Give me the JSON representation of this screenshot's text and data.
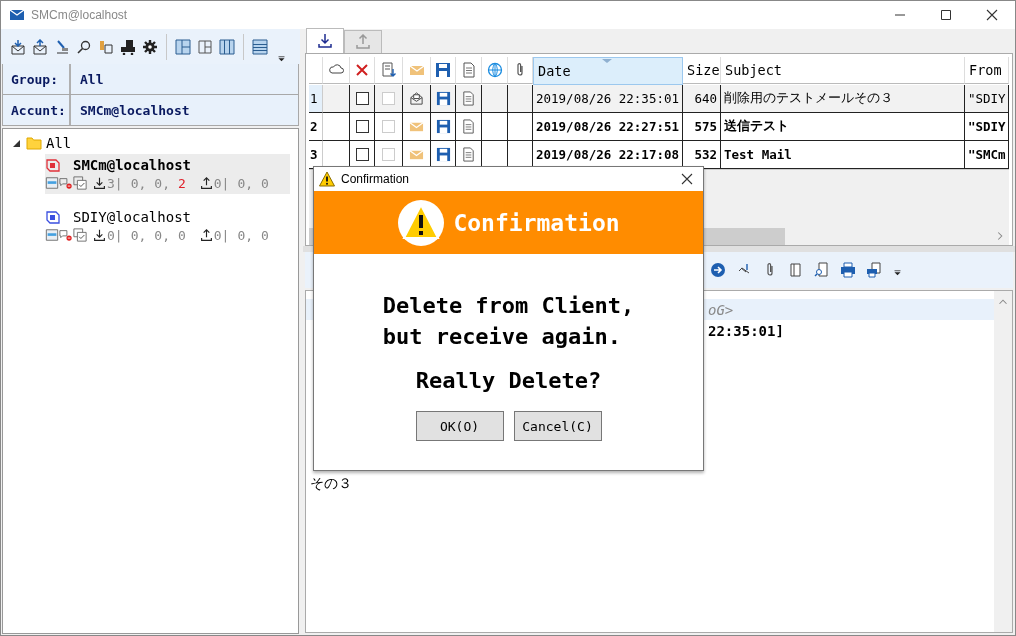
{
  "window": {
    "title": "SMCm@localhost"
  },
  "sidebar": {
    "group": {
      "label": "Group:",
      "value": "All"
    },
    "account": {
      "label": "Accunt:",
      "value": "SMCm@localhost"
    },
    "tree": [
      {
        "label": "All",
        "expanded": true,
        "children": [
          {
            "label": "SMCm@localhost",
            "selected": true,
            "color": "#e0303a",
            "received": [
              {
                "text": "3|",
                "alert": false
              },
              {
                "text": "0,",
                "alert": false
              },
              {
                "text": "0,",
                "alert": false
              },
              {
                "text": "2",
                "alert": true
              }
            ],
            "sent": [
              {
                "text": "0|",
                "alert": false
              },
              {
                "text": "0,",
                "alert": false
              },
              {
                "text": "0",
                "alert": false
              }
            ]
          },
          {
            "label": "SDIY@localhost",
            "selected": false,
            "color": "#3a4fe0",
            "received": [
              {
                "text": "0|",
                "alert": false
              },
              {
                "text": "0,",
                "alert": false
              },
              {
                "text": "0,",
                "alert": false
              },
              {
                "text": "0",
                "alert": false
              }
            ],
            "sent": [
              {
                "text": "0|",
                "alert": false
              },
              {
                "text": "0,",
                "alert": false
              },
              {
                "text": "0",
                "alert": false
              }
            ]
          }
        ]
      }
    ]
  },
  "tabs": [
    {
      "kind": "receive",
      "selected": true
    },
    {
      "kind": "send",
      "selected": false
    }
  ],
  "table": {
    "columns": [
      {
        "kind": "cloud"
      },
      {
        "kind": "delete"
      },
      {
        "kind": "fetch"
      },
      {
        "kind": "mail"
      },
      {
        "kind": "save"
      },
      {
        "kind": "document"
      },
      {
        "kind": "web"
      },
      {
        "kind": "attachment"
      },
      {
        "kind": "text",
        "label": "Date",
        "sorted": true
      },
      {
        "kind": "text",
        "label": "Size",
        "sorted": false
      },
      {
        "kind": "text",
        "label": "Subject",
        "sorted": false
      },
      {
        "kind": "text",
        "label": "From",
        "sorted": false
      }
    ],
    "rows": [
      {
        "number": "1",
        "selected": true,
        "unread": false,
        "checked": false,
        "fetch": {
          "checked": false,
          "disabled": true
        },
        "date": "2019/08/26 22:35:01",
        "size": "640",
        "subject": "削除用のテストメールその３",
        "from": "\"SDIY"
      },
      {
        "number": "2",
        "selected": false,
        "unread": true,
        "checked": false,
        "fetch": {
          "checked": false,
          "disabled": true
        },
        "date": "2019/08/26 22:27:51",
        "size": "575",
        "subject": "送信テスト",
        "from": "\"SDIY"
      },
      {
        "number": "3",
        "selected": false,
        "unread": true,
        "checked": false,
        "fetch": {
          "checked": false,
          "disabled": true
        },
        "date": "2019/08/26 22:17:08",
        "size": "532",
        "subject": "Test Mail",
        "from": "\"SMCm"
      }
    ]
  },
  "preview": {
    "lines": [
      {
        "text": "oG>",
        "highlight": true
      },
      {
        "text": "22:35:01]",
        "highlight": false
      }
    ],
    "after": "その３"
  },
  "dialog": {
    "title": "Confirmation",
    "heading": "Confirmation",
    "message": [
      "Delete from Client,",
      "but receive again."
    ],
    "question": "Really Delete?",
    "buttons": [
      "OK(O)",
      "Cancel(C)"
    ]
  }
}
